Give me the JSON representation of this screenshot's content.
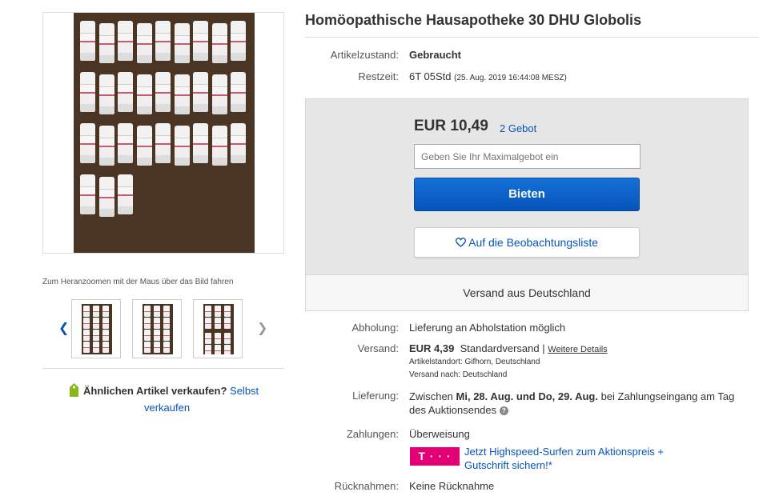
{
  "listing": {
    "title": "Homöopathische Hausapotheke 30 DHU Globolis"
  },
  "gallery": {
    "zoom_hint": "Zum Heranzoomen mit der Maus über das Bild fahren",
    "prev_icon": "chevron-left-icon",
    "next_icon": "chevron-right-icon",
    "thumbnail_count": 3
  },
  "sell_similar": {
    "text": "Ähnlichen Artikel verkaufen?",
    "link_part1": "Selbst",
    "link_part2": "verkaufen",
    "icon": "price-tag-icon"
  },
  "details": {
    "condition_label": "Artikelzustand:",
    "condition_value": "Gebraucht",
    "time_left_label": "Restzeit:",
    "time_left_value": "6T 05Std",
    "time_left_end": "(25. Aug. 2019  16:44:08 MESZ)"
  },
  "bid": {
    "price": "EUR 10,49",
    "bids_link": "2 Gebot",
    "input_placeholder": "Geben Sie Ihr Maximalgebot ein",
    "bid_button": "Bieten",
    "watch_button": "Auf die Beobachtungsliste",
    "watch_icon": "heart-icon",
    "ship_from": "Versand aus Deutschland"
  },
  "shipping": {
    "pickup_label": "Abholung:",
    "pickup_value": "Lieferung an Abholstation möglich",
    "shipping_label": "Versand:",
    "shipping_price": "EUR 4,39",
    "shipping_type": "Standardversand",
    "shipping_sep": "|",
    "details_link": "Weitere Details",
    "location_line": "Artikelstandort:  Gifhorn, Deutschland",
    "ships_to_line": "Versand nach:  Deutschland",
    "delivery_label": "Lieferung:",
    "delivery_prefix": "Zwischen ",
    "delivery_dates": "Mi, 28. Aug. und Do, 29. Aug.",
    "delivery_suffix": " bei Zahlungseingang am Tag",
    "delivery_line2": "des Auktionsendes",
    "payment_label": "Zahlungen:",
    "payment_value": "Überweisung",
    "promo_logo": "T · · ·",
    "promo_line1": "Jetzt Highspeed-Surfen zum Aktionspreis +",
    "promo_line2": "Gutschrift sichern!*",
    "returns_label": "Rücknahmen:",
    "returns_value": "Keine Rücknahme"
  },
  "colors": {
    "link": "#0654ba",
    "bid_button": "#0654ba",
    "telekom": "#e20074",
    "box_bg": "#e6e6e6"
  }
}
